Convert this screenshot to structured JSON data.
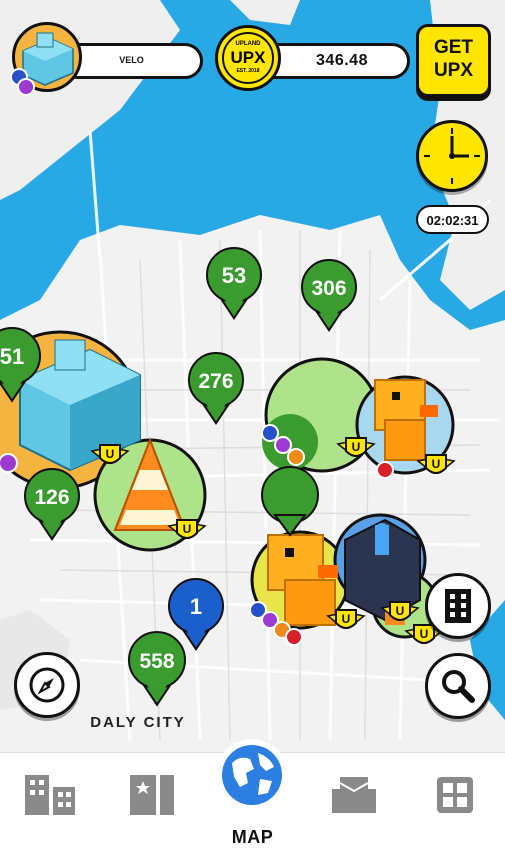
{
  "profile": {
    "name": "VELO"
  },
  "balance": {
    "coin_top": "UPLAND",
    "coin_mid": "UPX",
    "coin_bottom": "EST. 2018",
    "amount": "346.48"
  },
  "get_upx": {
    "line1": "GET",
    "line2": "UPX"
  },
  "timer": {
    "value": "02:02:31"
  },
  "map": {
    "city_label": "DALY CITY",
    "markers": [
      {
        "label": "53",
        "color": "#3a9b2e"
      },
      {
        "label": "306",
        "color": "#3a9b2e"
      },
      {
        "label": "276",
        "color": "#3a9b2e"
      },
      {
        "label": "51",
        "color": "#3a9b2e"
      },
      {
        "label": "126",
        "color": "#3a9b2e"
      },
      {
        "label": "1",
        "color": "#1a5fcc"
      },
      {
        "label": "558",
        "color": "#3a9b2e"
      }
    ],
    "badge_letter": "U"
  },
  "nav": {
    "active_label": "MAP"
  },
  "colors": {
    "water": "#28a9e6",
    "land": "#f2f2f2",
    "accent_yellow": "#ffe500",
    "marker_green": "#3a9b2e",
    "marker_blue": "#1a5fcc"
  }
}
